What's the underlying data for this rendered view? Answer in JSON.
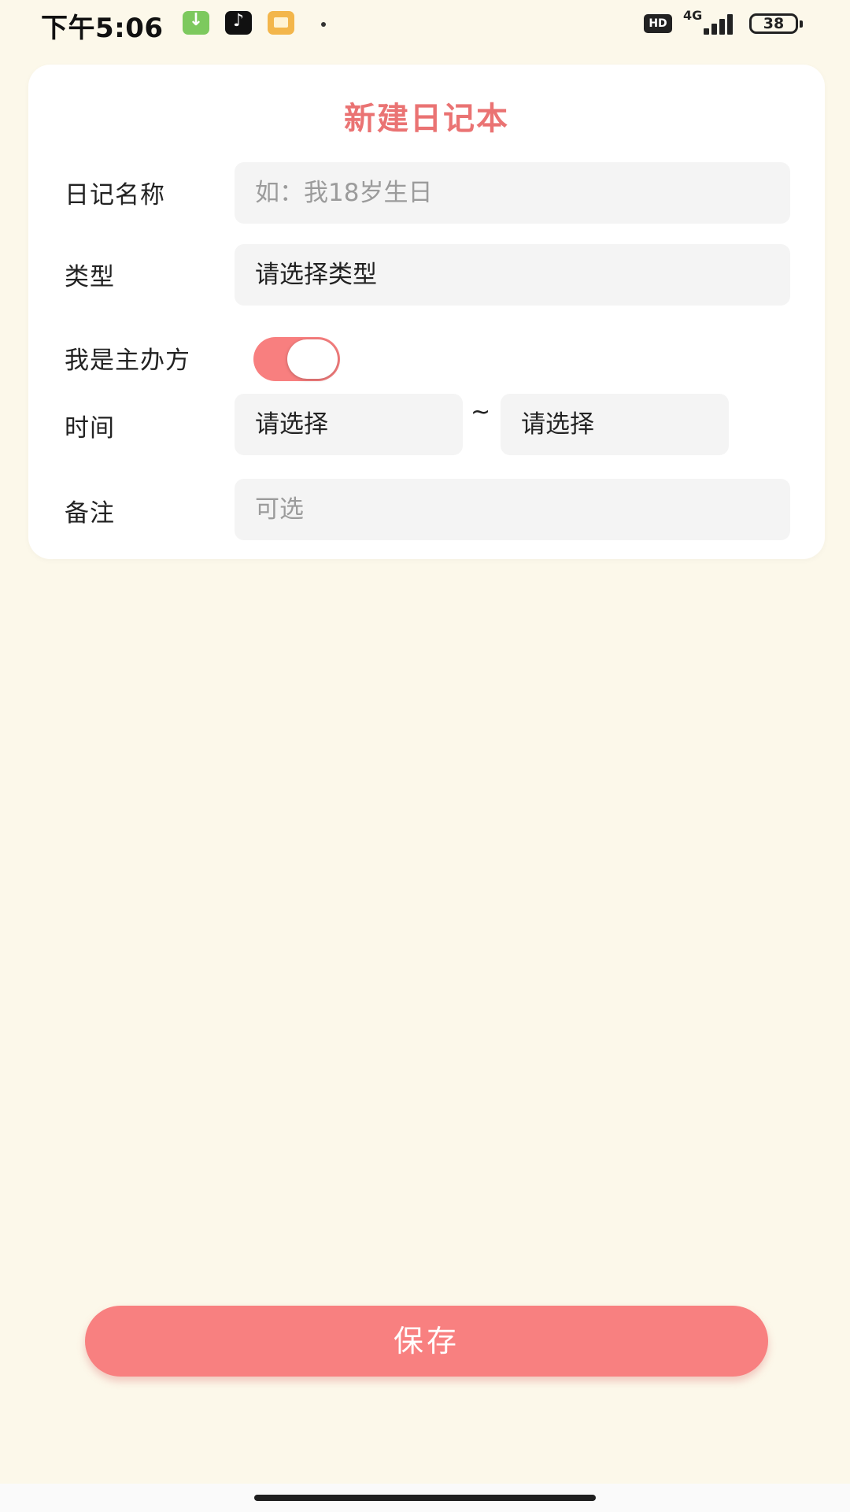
{
  "status_bar": {
    "time": "下午5:06",
    "app_icons": [
      "download-app-icon",
      "tiktok-icon",
      "message-app-icon"
    ],
    "hd_label": "HD",
    "network": "4G",
    "battery": "38"
  },
  "form": {
    "title": "新建日记本",
    "name_label": "日记名称",
    "name_placeholder": "如：我18岁生日",
    "type_label": "类型",
    "type_value": "请选择类型",
    "host_label": "我是主办方",
    "host_toggle_on": true,
    "time_label": "时间",
    "time_start": "请选择",
    "time_separator": "~",
    "time_end": "请选择",
    "note_label": "备注",
    "note_placeholder": "可选"
  },
  "actions": {
    "save_label": "保存"
  },
  "colors": {
    "accent": "#f88080",
    "title": "#ea7373",
    "background": "#fcf8ea",
    "field_bg": "#f4f4f4"
  }
}
